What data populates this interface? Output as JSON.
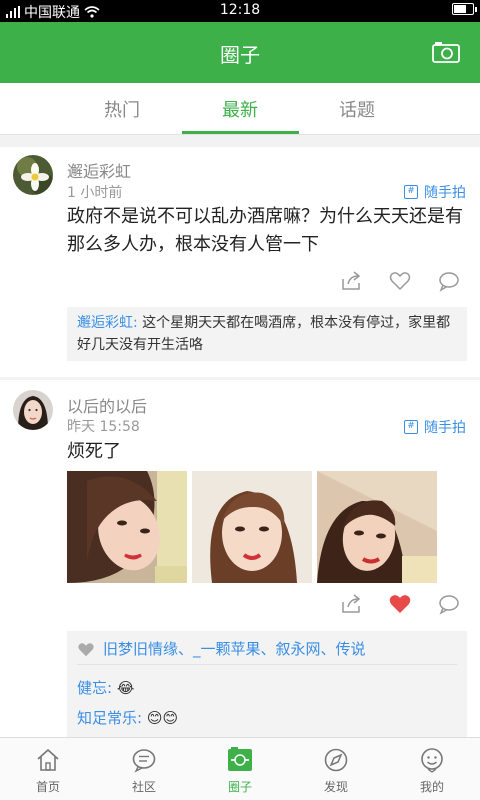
{
  "status_bar": {
    "carrier": "中国联通",
    "time": "12:18",
    "battery_level": 0.65
  },
  "header": {
    "title": "圈子",
    "camera_icon": "camera-icon"
  },
  "tabs": [
    {
      "label": "热门",
      "active": false
    },
    {
      "label": "最新",
      "active": true
    },
    {
      "label": "话题",
      "active": false
    }
  ],
  "posts": [
    {
      "username": "邂逅彩虹",
      "time": "1 小时前",
      "source": "随手拍",
      "content": "政府不是说不可以乱办酒席嘛？为什么天天还是有那么多人办，根本没有人管一下",
      "liked": false,
      "comments": [
        {
          "name": "邂逅彩虹:",
          "text": " 这个星期天天都在喝酒席，根本没有停过，家里都好几天没有开生活咯"
        }
      ]
    },
    {
      "username": "以后的以后",
      "time": "昨天 15:58",
      "source": "随手拍",
      "content": "烦死了",
      "liked": true,
      "likes_text": "旧梦旧情缘、_一颗苹果、叙永网、传说",
      "comments": [
        {
          "name": "健忘:",
          "text": " 😂"
        },
        {
          "name": "知足常乐:",
          "text": " 😊😊"
        }
      ]
    }
  ],
  "bottom_nav": [
    {
      "label": "首页",
      "icon": "home-icon",
      "active": false
    },
    {
      "label": "社区",
      "icon": "community-icon",
      "active": false
    },
    {
      "label": "圈子",
      "icon": "circle-icon",
      "active": true
    },
    {
      "label": "发现",
      "icon": "discover-icon",
      "active": false
    },
    {
      "label": "我的",
      "icon": "profile-icon",
      "active": false
    }
  ],
  "colors": {
    "brand_green": "#3db04a",
    "link_blue": "#3a8ee6",
    "like_red": "#e84a4a"
  }
}
